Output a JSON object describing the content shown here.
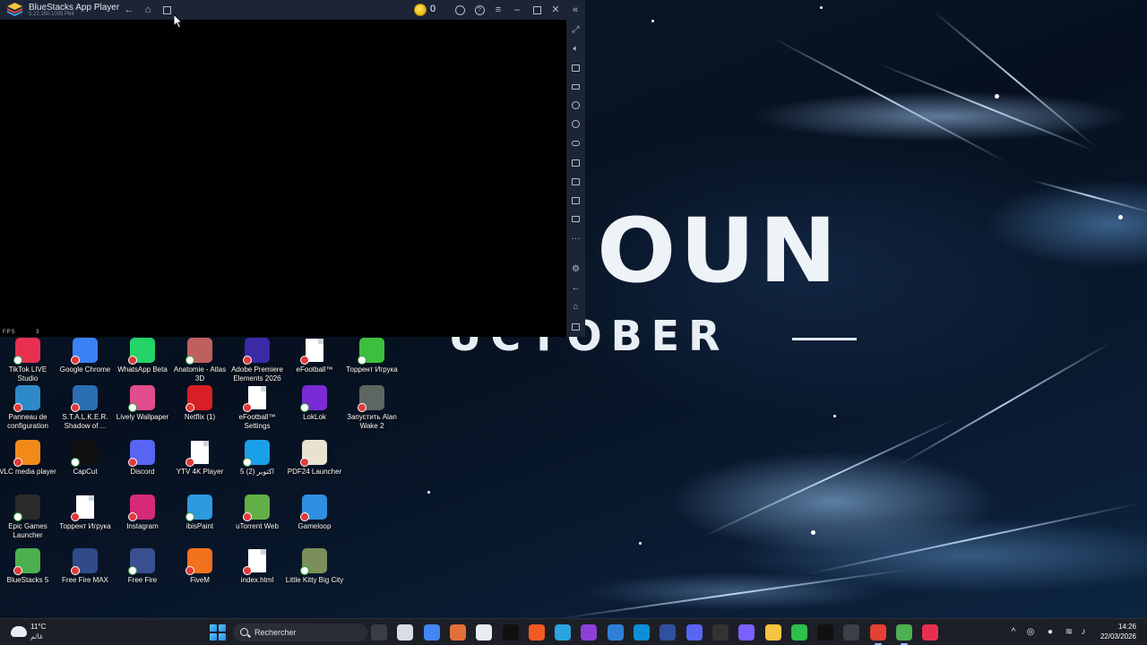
{
  "bluestacks": {
    "title": "BlueStacks App Player",
    "version": "5.22.150.1005 P64",
    "coins": "0",
    "fps_label": "FPS",
    "fps_value": "3",
    "titlebar_icons": [
      "back-icon",
      "home-icon",
      "multi-instance-icon",
      "account-icon",
      "help-icon",
      "menu-icon",
      "minimize-icon",
      "maximize-icon",
      "close-icon",
      "collapse-sidebar-icon"
    ],
    "sidebar_icons": [
      "fullscreen-icon",
      "volume-icon",
      "media-icon",
      "keyboard-icon",
      "rotate-icon",
      "shake-icon",
      "gamepad-icon",
      "macro-icon",
      "screenshot-icon",
      "record-icon",
      "folder-icon",
      "more-icon",
      "settings-icon",
      "back-icon",
      "home-icon",
      "recent-apps-icon"
    ]
  },
  "wallpaper": {
    "big_text": "OUN",
    "sub_text": "UCTOBER"
  },
  "desktop": {
    "row1": [
      {
        "label": "TikTok LIVE Studio",
        "icon": "tiktok-live-icon",
        "color": "#e7304f"
      },
      {
        "label": "Google Chrome",
        "icon": "chrome-icon",
        "color": "#3b82f6"
      },
      {
        "label": "WhatsApp Beta",
        "icon": "whatsapp-icon",
        "color": "#25d366"
      },
      {
        "label": "Anatomie - Atlas 3D",
        "icon": "anatomy-icon",
        "color": "#c0605e"
      },
      {
        "label": "Adobe Premiere Elements 2026",
        "icon": "premiere-icon",
        "color": "#3a2aa8"
      },
      {
        "label": "eFootball™",
        "icon": "document-icon",
        "color": "#ffffff"
      },
      {
        "label": "Торрент Игрука",
        "icon": "torrent-icon",
        "color": "#3cbf3c"
      }
    ],
    "row2": [
      {
        "label": "Panneau de configuration",
        "icon": "control-panel-icon",
        "color": "#2e89c9"
      },
      {
        "label": "S.T.A.L.K.E.R. Shadow of ...",
        "icon": "stalker-icon",
        "color": "#2a6fb3"
      },
      {
        "label": "Lively Wallpaper",
        "icon": "lively-icon",
        "color": "#e24d8b"
      },
      {
        "label": "Netflix (1)",
        "icon": "netflix-icon",
        "color": "#d81f26"
      },
      {
        "label": "eFootball™ Settings",
        "icon": "document-icon",
        "color": "#ffffff"
      },
      {
        "label": "LokLok",
        "icon": "loklok-icon",
        "color": "#7a2bd6"
      },
      {
        "label": "Запустить Alan Wake 2",
        "icon": "alan-wake-icon",
        "color": "#5d6660"
      }
    ],
    "row3": [
      {
        "label": "VLC media player",
        "icon": "vlc-icon",
        "color": "#f28a1a"
      },
      {
        "label": "CapCut",
        "icon": "capcut-icon",
        "color": "#111111"
      },
      {
        "label": "Discord",
        "icon": "discord-icon",
        "color": "#5865f2"
      },
      {
        "label": "YTV 4K Player",
        "icon": "document-icon",
        "color": "#ffffff"
      },
      {
        "label": "5 اكتوبر (2)",
        "icon": "app-h-icon",
        "color": "#1aa0e8"
      },
      {
        "label": "PDF24 Launcher",
        "icon": "pdf24-icon",
        "color": "#e8e2d0"
      }
    ],
    "row4": [
      {
        "label": "Epic Games Launcher",
        "icon": "epic-icon",
        "color": "#2a2a2a"
      },
      {
        "label": "Торрент Игрука",
        "icon": "document-icon",
        "color": "#ffffff"
      },
      {
        "label": "Instagram",
        "icon": "instagram-icon",
        "color": "#d62976"
      },
      {
        "label": "ibisPaint",
        "icon": "ibispaint-icon",
        "color": "#2d9ae0"
      },
      {
        "label": "uTorrent Web",
        "icon": "utorrent-icon",
        "color": "#62b045"
      },
      {
        "label": "Gameloop",
        "icon": "gameloop-icon",
        "color": "#2f8fe0"
      }
    ],
    "row5": [
      {
        "label": "BlueStacks 5",
        "icon": "bluestacks-icon",
        "color": "#4caf50"
      },
      {
        "label": "Free Fire MAX",
        "icon": "freefire-max-icon",
        "color": "#314a8a"
      },
      {
        "label": "Free Fire",
        "icon": "freefire-icon",
        "color": "#3a4f8f"
      },
      {
        "label": "FiveM",
        "icon": "fivem-icon",
        "color": "#f2711c"
      },
      {
        "label": "index.html",
        "icon": "document-icon",
        "color": "#ffffff"
      },
      {
        "label": "Little Kitty Big City",
        "icon": "kitty-icon",
        "color": "#7a8f5a"
      }
    ]
  },
  "taskbar": {
    "weather_temp": "11°C",
    "weather_desc": "غائم",
    "search_label": "Rechercher",
    "apps": [
      "task-view-icon",
      "copilot-icon",
      "chrome-icon",
      "games-icon",
      "file-icon",
      "capcut-icon",
      "office-icon",
      "telegram-icon",
      "tiktok-shop-icon",
      "copilot-app-icon",
      "edge-icon",
      "settings-app-icon",
      "discord-icon",
      "pen-icon",
      "palette-icon",
      "explorer-icon",
      "wechat-icon",
      "tiktok-icon",
      "snip-icon",
      "chrome-profile-icon",
      "bluestacks-icon",
      "tiktok-live-icon"
    ],
    "time": "14:26",
    "date": "22/03/2026"
  }
}
